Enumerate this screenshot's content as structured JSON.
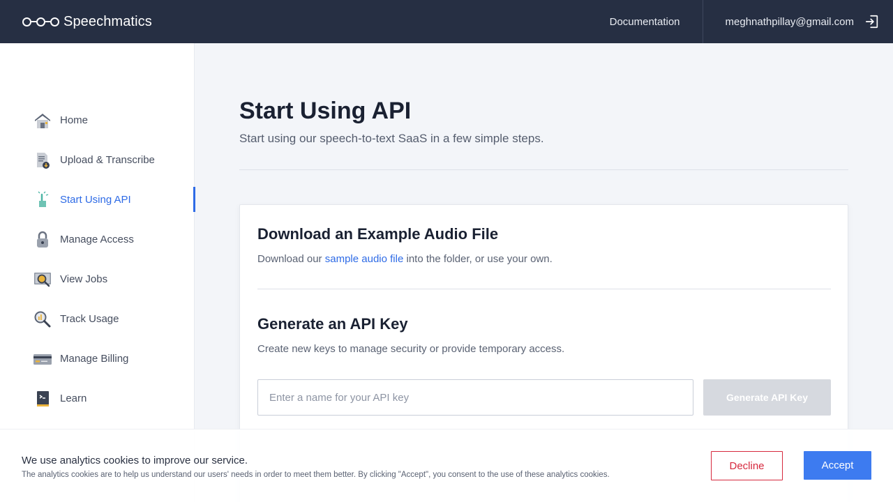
{
  "header": {
    "brand": "Speechmatics",
    "documentation_label": "Documentation",
    "user_email": "meghnathpillay@gmail.com",
    "logout_icon": "logout-icon"
  },
  "sidebar": {
    "items": [
      {
        "label": "Home",
        "icon": "home-icon"
      },
      {
        "label": "Upload & Transcribe",
        "icon": "upload-file-icon"
      },
      {
        "label": "Start Using API",
        "icon": "pointer-hand-icon",
        "active": true
      },
      {
        "label": "Manage Access",
        "icon": "lock-icon"
      },
      {
        "label": "View Jobs",
        "icon": "view-jobs-icon"
      },
      {
        "label": "Track Usage",
        "icon": "track-usage-icon"
      },
      {
        "label": "Manage Billing",
        "icon": "credit-card-icon"
      },
      {
        "label": "Learn",
        "icon": "book-icon"
      }
    ]
  },
  "main": {
    "title": "Start Using API",
    "subtitle": "Start using our speech-to-text SaaS in a few simple steps.",
    "download": {
      "title": "Download an Example Audio File",
      "text_before": "Download our ",
      "link": "sample audio file",
      "text_after": " into the folder, or use your own."
    },
    "generate": {
      "title": "Generate an API Key",
      "text": "Create new keys to manage security or provide temporary access.",
      "input_placeholder": "Enter a name for your API key",
      "input_value": "",
      "button_label": "Generate API Key"
    }
  },
  "cookie_banner": {
    "title": "We use analytics cookies to improve our service.",
    "text": "The analytics cookies are to help us understand our users' needs in order to meet them better. By clicking \"Accept\", you consent to the use of these analytics cookies.",
    "decline_label": "Decline",
    "accept_label": "Accept"
  },
  "colors": {
    "topbar": "#262f43",
    "accent": "#2e6be6",
    "accept": "#3d7bf0",
    "decline": "#d6283d"
  }
}
